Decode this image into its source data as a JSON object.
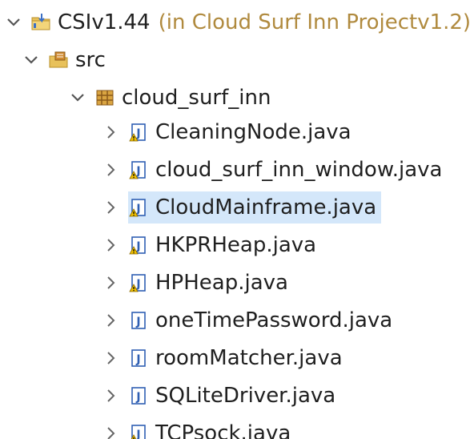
{
  "project": {
    "name": "CSIv1.44",
    "decoration": "(in Cloud Surf Inn Projectv1.2)",
    "expanded": true,
    "icon": "java-project-icon"
  },
  "source_folder": {
    "name": "src",
    "expanded": true,
    "icon": "source-folder-icon"
  },
  "package": {
    "name": "cloud_surf_inn",
    "expanded": true,
    "icon": "package-icon"
  },
  "files": [
    {
      "name": "CleaningNode.java",
      "warning": true,
      "selected": false
    },
    {
      "name": "cloud_surf_inn_window.java",
      "warning": true,
      "selected": false
    },
    {
      "name": "CloudMainframe.java",
      "warning": true,
      "selected": true
    },
    {
      "name": "HKPRHeap.java",
      "warning": true,
      "selected": false
    },
    {
      "name": "HPHeap.java",
      "warning": true,
      "selected": false
    },
    {
      "name": "oneTimePassword.java",
      "warning": false,
      "selected": false
    },
    {
      "name": "roomMatcher.java",
      "warning": false,
      "selected": false
    },
    {
      "name": "SQLiteDriver.java",
      "warning": false,
      "selected": false
    },
    {
      "name": "TCPsock.java",
      "warning": true,
      "selected": false
    }
  ],
  "colors": {
    "selection": "#d4e7fa",
    "decoration": "#b08a3e",
    "chevron": "#555555",
    "java_file_blue": "#2f5fb3",
    "warning_yellow": "#f2c200"
  }
}
